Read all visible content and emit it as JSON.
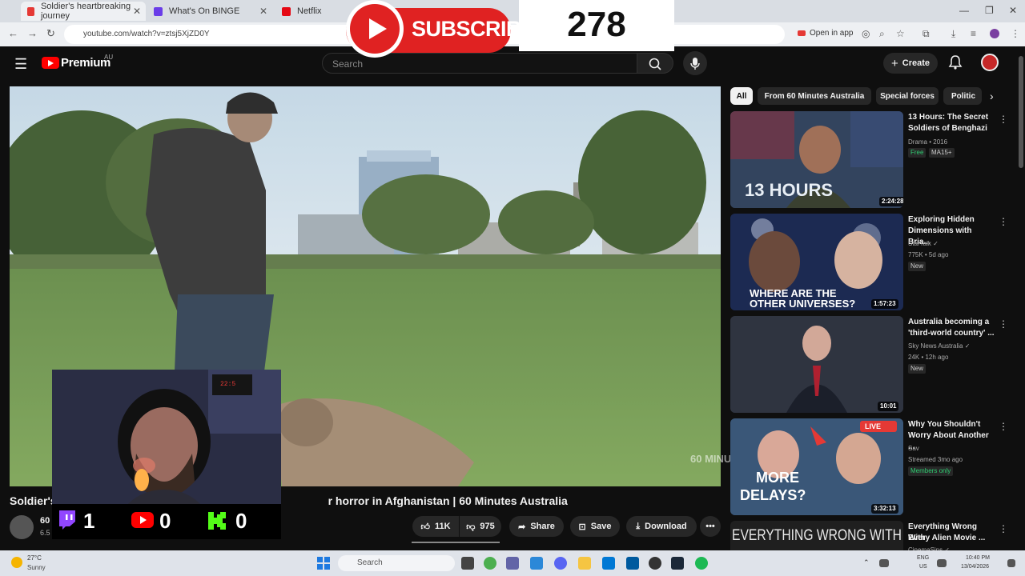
{
  "browser": {
    "tabs": [
      {
        "label": "Soldier's heartbreaking journey",
        "favicon_color": "#e53935"
      },
      {
        "label": "What's On BINGE",
        "favicon_color": "#6a3de8"
      },
      {
        "label": "Netflix",
        "favicon_color": "#e50914"
      }
    ],
    "url": "youtube.com/watch?v=ztsj5XjZD0Y",
    "open_in_app": "Open in app"
  },
  "youtube": {
    "logo_text": "Premium",
    "region": "AU",
    "search_placeholder": "Search",
    "create_label": "Create"
  },
  "overlay": {
    "subscribe_label": "SUBSCRIBE",
    "subscriber_count": "278",
    "stats": {
      "twitch": "1",
      "youtube": "0",
      "kick": "0"
    }
  },
  "video": {
    "title": "Soldier's heartbreaking journey after horror in Afghanistan | 60 Minutes Australia",
    "title_visible_prefix": "Soldier's",
    "title_visible_suffix": "r horror in Afghanistan | 60 Minutes Australia",
    "watermark": "60 MINUTES",
    "channel_name": "60",
    "subscribers": "6.5",
    "likes": "11K",
    "dislikes": "975",
    "share_label": "Share",
    "save_label": "Save",
    "download_label": "Download"
  },
  "chips": [
    "All",
    "From 60 Minutes Australia",
    "Special forces",
    "Politic"
  ],
  "recommendations": [
    {
      "title_line1": "13 Hours: The Secret",
      "title_line2": "Soldiers of Benghazi",
      "meta1": "Drama • 2016",
      "meta2": "",
      "badges": [
        "Free",
        "MA15+"
      ],
      "duration": "2:24:28",
      "thumb_text": "13 HOURS"
    },
    {
      "title_line1": "Exploring Hidden",
      "title_line2": "Dimensions with Bria...",
      "meta1": "StarTalk ✓",
      "meta2": "775K • 5d ago",
      "badges": [
        "New"
      ],
      "duration": "1:57:23",
      "thumb_text": "WHERE ARE THE OTHER UNIVERSES?"
    },
    {
      "title_line1": "Australia becoming a",
      "title_line2": "'third-world country' ...",
      "meta1": "Sky News Australia ✓",
      "meta2": "24K • 12h ago",
      "badges": [
        "New"
      ],
      "duration": "10:01",
      "thumb_text": ""
    },
    {
      "title_line1": "Why You Shouldn't",
      "title_line2": "Worry About Another ...",
      "meta1": "Sav",
      "meta2": "Streamed 3mo ago",
      "badges": [
        "Members only"
      ],
      "duration": "3:32:13",
      "thumb_text": "MORE DELAYS?"
    },
    {
      "title_line1": "Everything Wrong With",
      "title_line2": "Every Alien Movie ...",
      "meta1": "CinemaSins ✓",
      "meta2": "",
      "badges": [],
      "duration": "",
      "thumb_text": "EVERYTHING WRONG WITH"
    }
  ],
  "taskbar": {
    "weather_temp": "27°C",
    "weather_desc": "Sunny",
    "search_placeholder": "Search",
    "lang1": "ENG",
    "lang2": "US",
    "time": "10:40 PM",
    "date": "13/04/2026"
  },
  "colors": {
    "youtube_red": "#ff0000",
    "subscribe_red": "#e02222",
    "twitch_purple": "#9146ff",
    "kick_green": "#53fc18"
  }
}
